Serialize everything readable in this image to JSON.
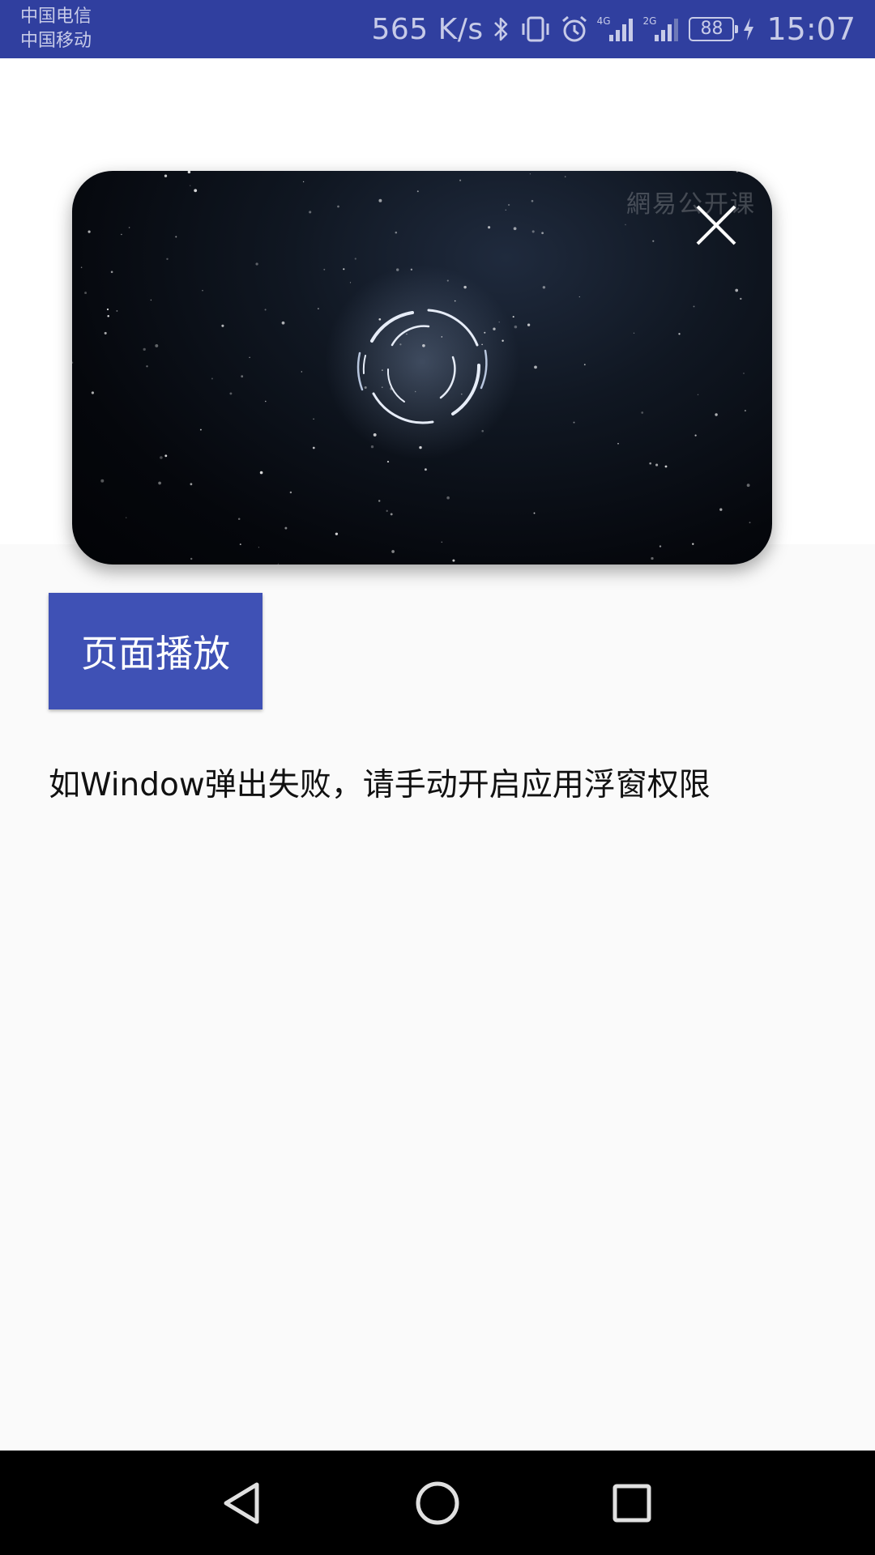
{
  "status_bar": {
    "carrier_1": "中国电信",
    "carrier_2": "中国移动",
    "net_speed": "565 K/s",
    "network_1": "4G",
    "network_2": "2G",
    "battery": "88",
    "time": "15:07"
  },
  "video": {
    "watermark": "網易公开课",
    "close_icon": "close-icon"
  },
  "main": {
    "play_button_label": "页面播放",
    "hint": "如Window弹出失败，请手动开启应用浮窗权限"
  },
  "nav_bar": {
    "back_icon": "triangle-back-icon",
    "home_icon": "circle-home-icon",
    "recent_icon": "square-recent-icon"
  },
  "colors": {
    "status_bar": "#303f9f",
    "accent": "#3f51b5",
    "background": "#fafafa"
  }
}
